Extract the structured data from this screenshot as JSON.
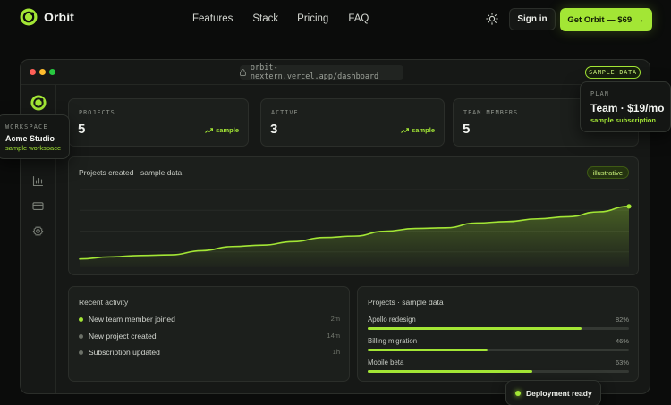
{
  "nav": {
    "brand": "Orbit",
    "links": [
      "Features",
      "Stack",
      "Pricing",
      "FAQ"
    ],
    "signin_label": "Sign in",
    "cta_label": "Get Orbit — $69",
    "cta_arrow": "→",
    "theme_icon": "sun-icon"
  },
  "colors": {
    "accent": "#a3e635",
    "background": "#0b0c0b",
    "card": "#1c1f1c"
  },
  "window": {
    "url": "orbit-nextern.vercel.app/dashboard",
    "badge": "SAMPLE DATA",
    "traffic_lights": [
      "#ff5f57",
      "#febc2e",
      "#28c840"
    ]
  },
  "sidebar": {
    "icons": [
      "orbit-logo-icon",
      "chart-bar-icon",
      "credit-card-icon",
      "gear-icon"
    ]
  },
  "stats": [
    {
      "label": "PROJECTS",
      "value": "5",
      "delta": "sample"
    },
    {
      "label": "ACTIVE",
      "value": "3",
      "delta": "sample"
    },
    {
      "label": "TEAM MEMBERS",
      "value": "5"
    }
  ],
  "chart": {
    "title": "Projects created · sample data",
    "badge": "illustrative"
  },
  "chart_data": {
    "type": "area",
    "title": "Projects created · sample data",
    "xlabel": "",
    "ylabel": "",
    "grid": true,
    "legend": "none",
    "series": [
      {
        "values": [
          12,
          15,
          17,
          18,
          24,
          30,
          32,
          37,
          43,
          45,
          52,
          56,
          57,
          64,
          66,
          70,
          73,
          80,
          88
        ]
      }
    ],
    "ylim": [
      0,
      120
    ]
  },
  "activity": {
    "title": "Recent activity",
    "items": [
      {
        "text": "New team member joined",
        "time": "2m",
        "highlight": true
      },
      {
        "text": "New project created",
        "time": "14m",
        "highlight": false
      },
      {
        "text": "Subscription updated",
        "time": "1h",
        "highlight": false
      }
    ]
  },
  "projects": {
    "title": "Projects · sample data",
    "items": [
      {
        "name": "Apollo redesign",
        "pct_label": "82%",
        "progress": 0.82
      },
      {
        "name": "Billing migration",
        "pct_label": "46%",
        "progress": 0.46
      },
      {
        "name": "Mobile beta",
        "pct_label": "63%",
        "progress": 0.63
      }
    ]
  },
  "workspace_popover": {
    "label": "WORKSPACE",
    "name": "Acme Studio",
    "sub": "sample workspace"
  },
  "plan_popover": {
    "label": "PLAN",
    "name": "Team · $19/mo",
    "sub": "sample subscription"
  },
  "toast": {
    "text": "Deployment ready"
  }
}
